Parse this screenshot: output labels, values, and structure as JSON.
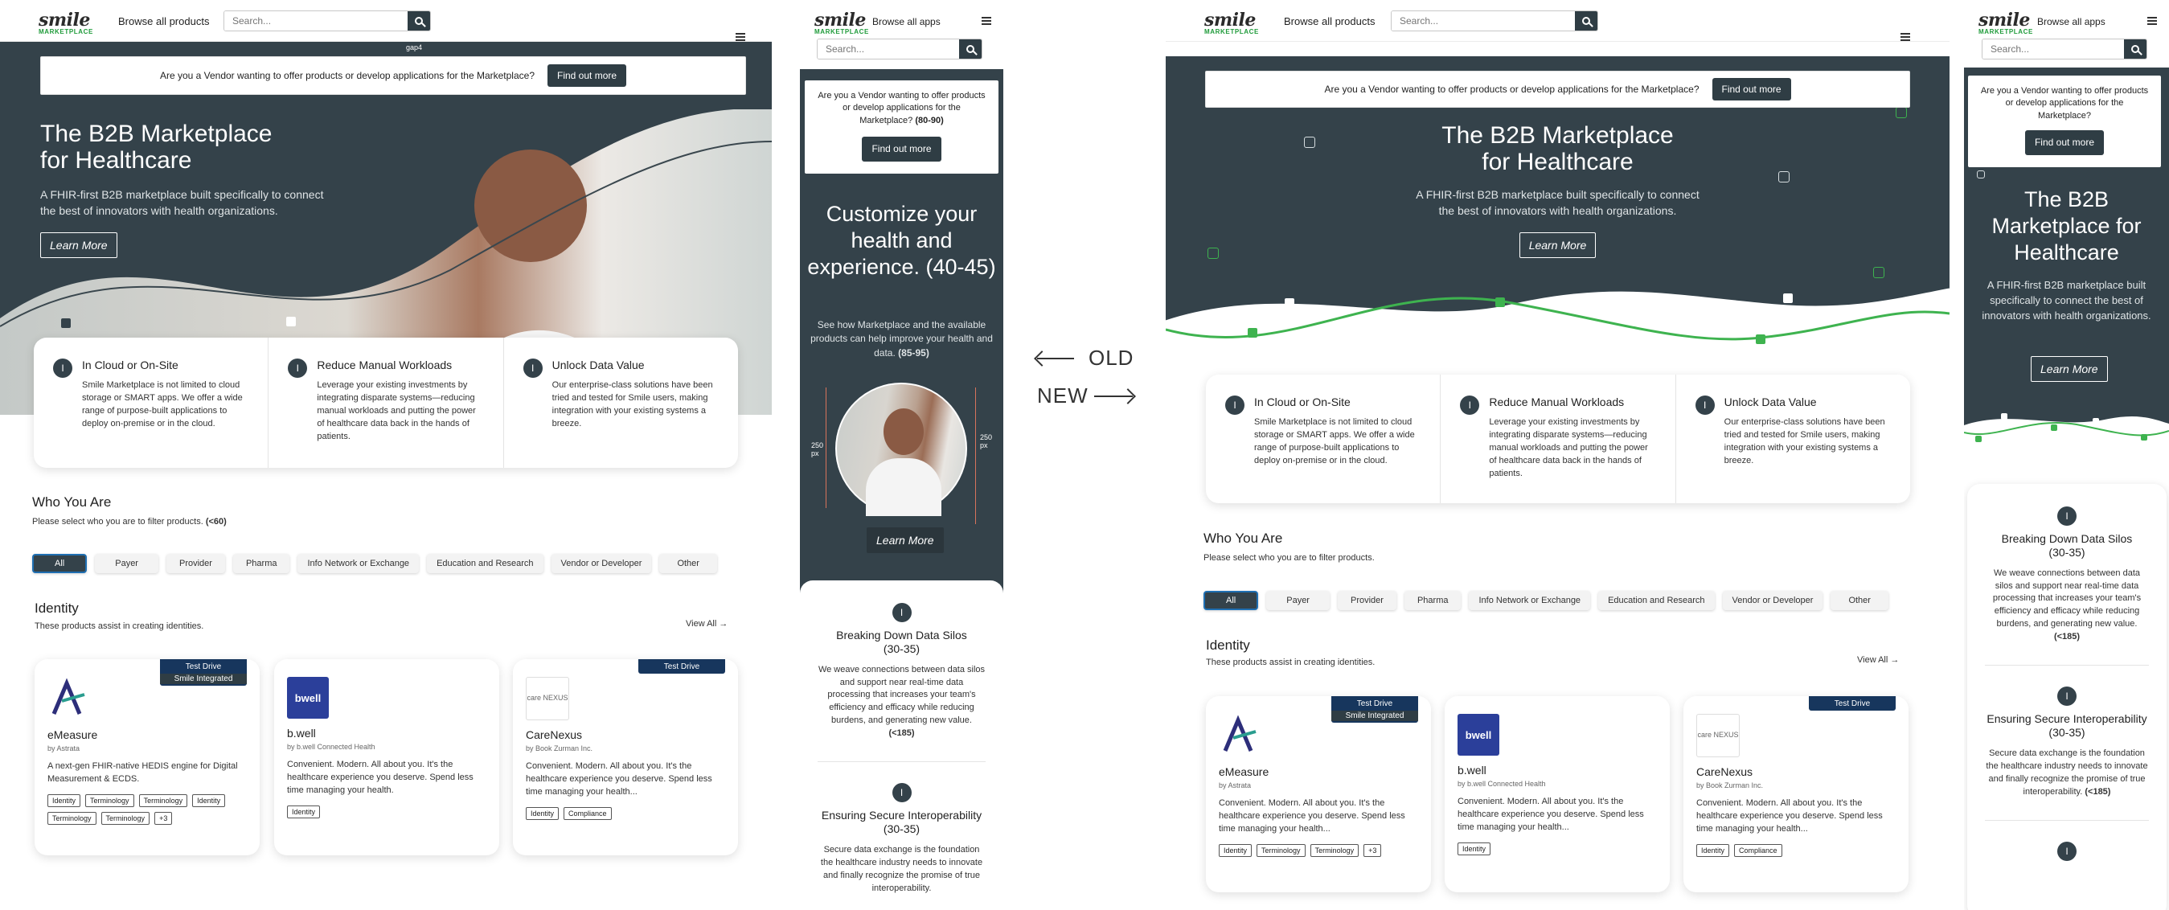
{
  "brand": {
    "logo_main": "smile",
    "logo_sub": "MARKETPLACE"
  },
  "nav": {
    "browse_products": "Browse all products",
    "browse_apps": "Browse all apps",
    "search_placeholder": "Search..."
  },
  "vendor": {
    "text": "Are you a Vendor wanting to offer products or develop applications for the Marketplace?",
    "text_mobile": "Are you a Vendor wanting to offer products or develop applications for the Marketplace?",
    "note_mobile": "(80-90)",
    "button": "Find out more"
  },
  "annot": {
    "gap": "gap4",
    "dim_left": "250 px",
    "dim_right": "250 px"
  },
  "hero": {
    "title_line1": "The B2B Marketplace",
    "title_line2": "for Healthcare",
    "subtitle_line1": "A FHIR-first B2B marketplace built specifically to connect",
    "subtitle_line2": "the best of innovators with health organizations.",
    "mobile_title": "The B2B Marketplace for Healthcare",
    "mobile_subtitle": "A FHIR-first B2B marketplace built specifically to connect the best of innovators with health organizations.",
    "cta": "Learn More"
  },
  "mobile_old": {
    "title": "Customize your health and experience.",
    "title_note": "(40-45)",
    "subtitle": "See how Marketplace and the available products can help improve your health and data.",
    "subtitle_note": "(85-95)"
  },
  "features": [
    {
      "icon": "I",
      "title": "In Cloud or On-Site",
      "body": "Smile Marketplace is not limited to cloud storage or SMART apps.  We offer a wide range of purpose-built applications to deploy on-premise or in the cloud."
    },
    {
      "icon": "I",
      "title": "Reduce Manual Workloads",
      "body": "Leverage your existing investments by integrating disparate systems—reducing manual workloads and putting the power of healthcare data back in the hands of patients."
    },
    {
      "icon": "I",
      "title": "Unlock Data Value",
      "body": "Our enterprise-class solutions have been tried and tested for Smile users, making integration with your existing systems a breeze."
    }
  ],
  "mobile_features": [
    {
      "icon": "I",
      "title": "Breaking Down Data Silos",
      "title_note": "(30-35)",
      "body": "We weave connections between data silos and support near real-time data processing that increases your team's efficiency and efficacy while reducing burdens, and generating new value.",
      "body_note": "(<185)"
    },
    {
      "icon": "I",
      "title": "Ensuring Secure Interoperability",
      "title_note": "(30-35)",
      "body": "Secure data exchange is the foundation the healthcare industry needs to innovate and finally recognize the promise of true interoperability.",
      "body_note": "(<185)"
    }
  ],
  "who": {
    "title": "Who You Are",
    "subtitle": "Please select who you are to filter products.",
    "subtitle_note": "(<60)",
    "filters": [
      "All",
      "Payer",
      "Provider",
      "Pharma",
      "Info Network or Exchange",
      "Education and Research",
      "Vendor or Developer",
      "Other"
    ]
  },
  "identity": {
    "title": "Identity",
    "subtitle": "These products assist in creating identities.",
    "view_all": "View All"
  },
  "products": [
    {
      "name": "eMeasure",
      "by": "by Astrata",
      "desc_old": "A next-gen FHIR-native HEDIS engine for Digital Measurement & ECDS.",
      "desc_new": "Convenient. Modern. All about you. It's the healthcare experience you deserve. Spend less time managing your health...",
      "badge": "Test Drive",
      "badge_sub": "Smile Integrated",
      "tags_old": [
        "Identity",
        "Terminology",
        "Terminology",
        "Identity",
        "Terminology",
        "Terminology",
        "+3"
      ],
      "tags_new": [
        "Identity",
        "Terminology",
        "Terminology",
        "+3"
      ]
    },
    {
      "name": "b.well",
      "by": "by b.well Connected Health",
      "logo_text": "bwell",
      "desc": "Convenient. Modern. All about you. It's the healthcare experience you deserve. Spend less time managing your health.",
      "desc_new": "Convenient. Modern. All about you. It's the healthcare experience you deserve. Spend less time managing your health...",
      "tags": [
        "Identity"
      ]
    },
    {
      "name": "CareNexus",
      "by": "by Book Zurman Inc.",
      "logo_text": "care NEXUS",
      "desc": "Convenient. Modern. All about you. It's the healthcare experience you deserve. Spend less time managing your health...",
      "badge": "Test Drive",
      "tags": [
        "Identity",
        "Compliance"
      ]
    }
  ],
  "labels": {
    "old": "OLD",
    "new": "NEW"
  },
  "colors": {
    "dark": "#34424a",
    "accent_green": "#3eb34f",
    "badge_navy": "#17365d"
  }
}
